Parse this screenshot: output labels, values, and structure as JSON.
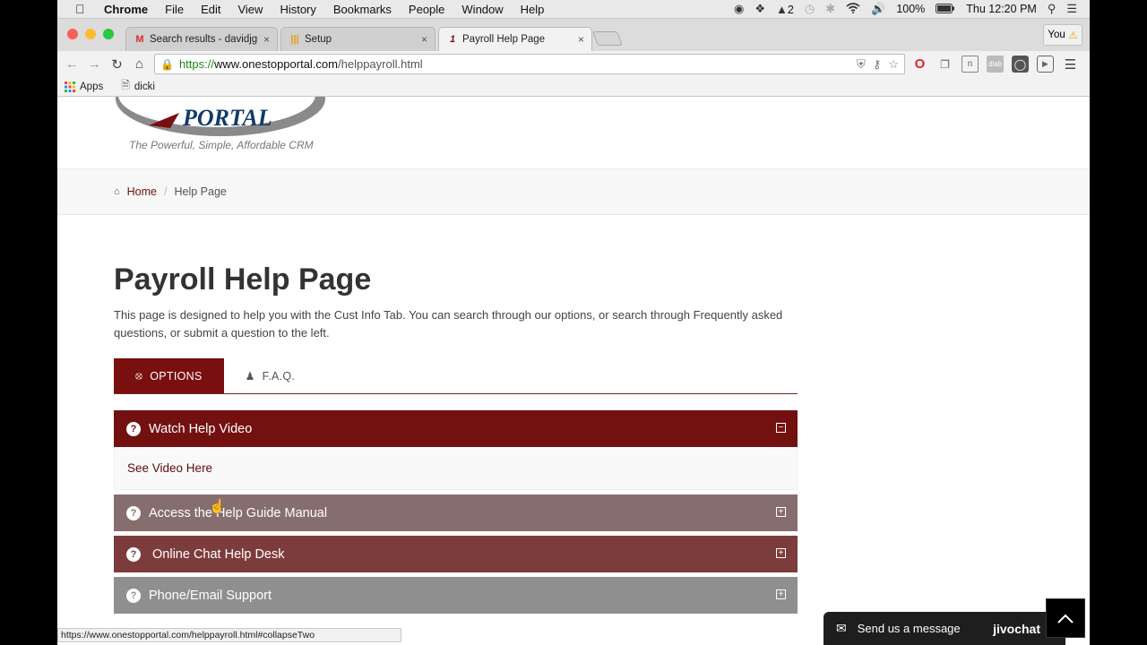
{
  "menubar": {
    "app": "Chrome",
    "items": [
      "File",
      "Edit",
      "View",
      "History",
      "Bookmarks",
      "People",
      "Window",
      "Help"
    ],
    "adobe_count": "2",
    "battery": "100%",
    "clock": "Thu 12:20 PM"
  },
  "tabs": [
    {
      "title": "Search results - davidjgrav",
      "icon": "gmail-icon"
    },
    {
      "title": "Setup",
      "icon": "setup-icon"
    },
    {
      "title": "Payroll Help Page",
      "icon": "portal-icon",
      "active": true
    }
  ],
  "profile": {
    "label": "You"
  },
  "address": {
    "scheme": "https://",
    "host": "www.onestopportal.com",
    "path": "/helppayroll.html"
  },
  "bookmarks": [
    {
      "label": "Apps",
      "icon": "apps-grid-icon"
    },
    {
      "label": "dicki",
      "icon": "page-icon"
    }
  ],
  "site": {
    "tagline": "The Powerful, Simple, Affordable CRM",
    "breadcrumb": {
      "home": "Home",
      "current": "Help Page"
    },
    "title": "Payroll Help Page",
    "intro": "This page is designed to help you with the Cust Info Tab. You can search through our options, or search through Frequently asked questions, or submit a question to the left.",
    "tabs": [
      {
        "label": "OPTIONS",
        "icon": "lifebuoy-icon",
        "active": true
      },
      {
        "label": "F.A.Q.",
        "icon": "user-icon",
        "active": false
      }
    ],
    "accordion": [
      {
        "label": "Watch Help Video",
        "expanded": true,
        "color": "#731111",
        "body_link": "See Video Here"
      },
      {
        "label": "Access the Help Guide Manual",
        "expanded": false,
        "color": "#876e6e"
      },
      {
        "label": "Online Chat Help Desk",
        "expanded": false,
        "color": "#7d3c3c"
      },
      {
        "label": "Phone/Email Support",
        "expanded": false,
        "color": "#8f8f8f"
      }
    ]
  },
  "status_url": "https://www.onestopportal.com/helppayroll.html#collapseTwo",
  "chat": {
    "label": "Send us a message",
    "brand": "jivochat"
  }
}
